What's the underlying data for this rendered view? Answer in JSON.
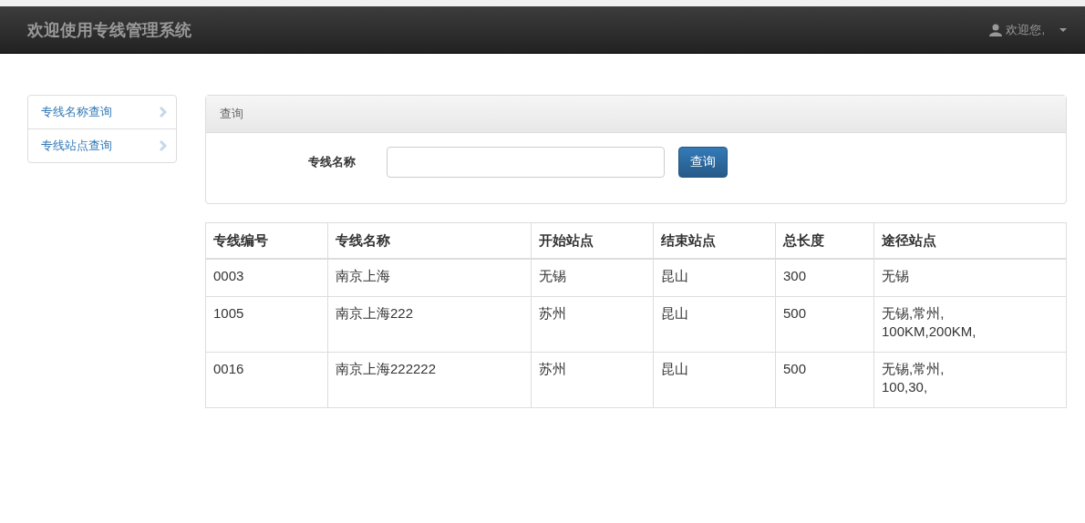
{
  "navbar": {
    "brand": "欢迎使用专线管理系统",
    "user": "欢迎您,"
  },
  "sidebar": {
    "items": [
      {
        "label": "专线名称查询"
      },
      {
        "label": "专线站点查询"
      }
    ]
  },
  "query_panel": {
    "title": "查询",
    "field_label": "专线名称",
    "button": "查询"
  },
  "table": {
    "columns": [
      "专线编号",
      "专线名称",
      "开始站点",
      "结束站点",
      "总长度",
      "途径站点"
    ],
    "rows": [
      [
        [
          "0003"
        ],
        [
          "南京上海"
        ],
        [
          "无锡"
        ],
        [
          "昆山"
        ],
        [
          "300"
        ],
        [
          "无锡"
        ]
      ],
      [
        [
          "1005"
        ],
        [
          "南京上海222"
        ],
        [
          "苏州"
        ],
        [
          "昆山"
        ],
        [
          "500"
        ],
        [
          "无锡,常州,",
          "100KM,200KM,"
        ]
      ],
      [
        [
          "0016"
        ],
        [
          "南京上海222222"
        ],
        [
          "苏州"
        ],
        [
          "昆山"
        ],
        [
          "500"
        ],
        [
          "无锡,常州,",
          "100,30,"
        ]
      ]
    ]
  }
}
